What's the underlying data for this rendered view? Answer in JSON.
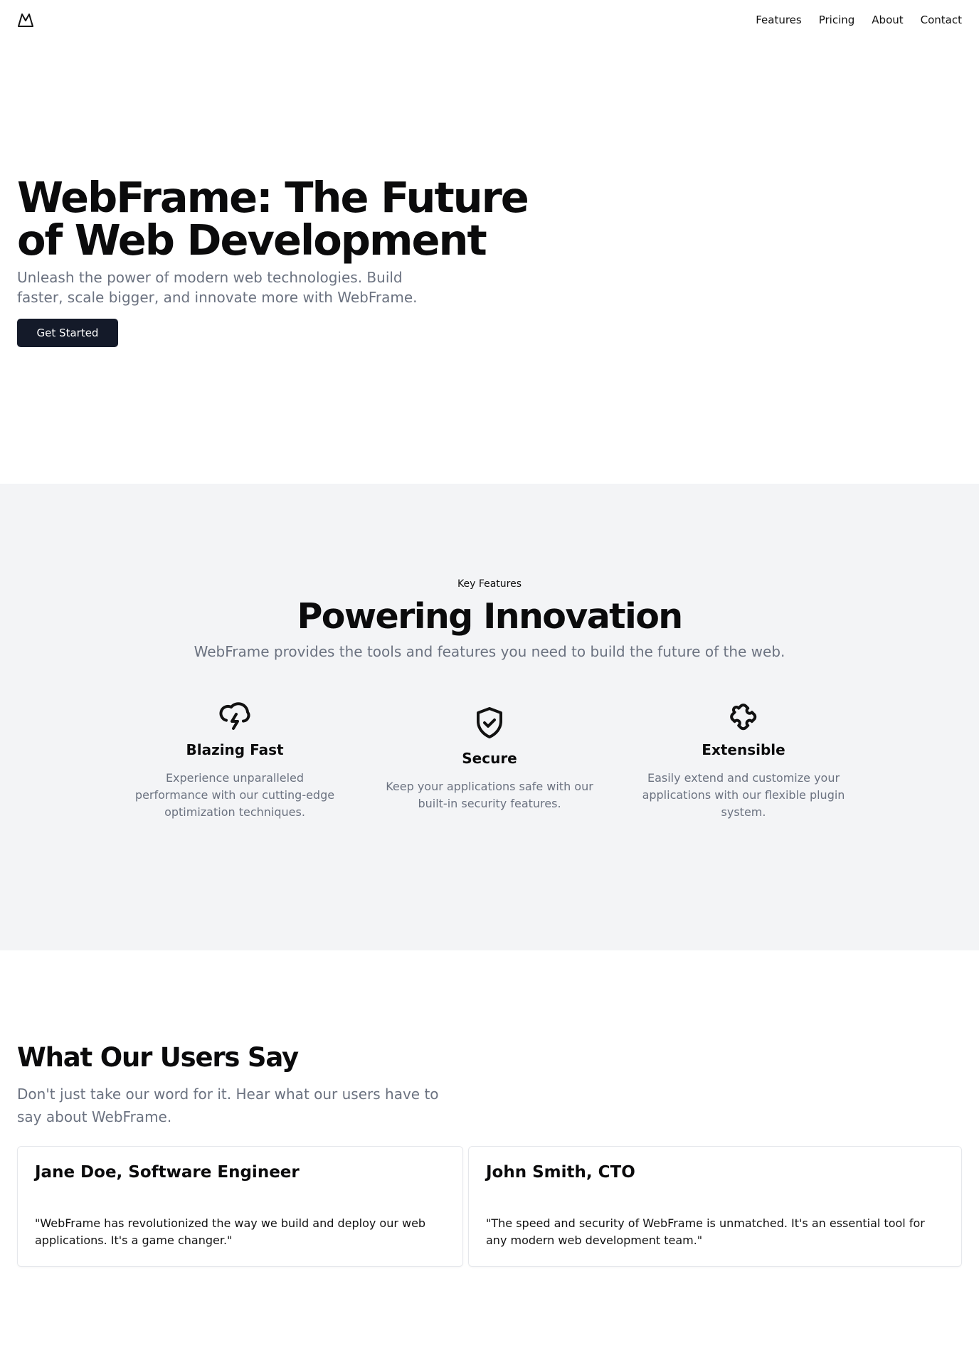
{
  "header": {
    "logo_icon": "mountain-icon",
    "nav": [
      {
        "label": "Features"
      },
      {
        "label": "Pricing"
      },
      {
        "label": "About"
      },
      {
        "label": "Contact"
      }
    ]
  },
  "hero": {
    "title": "WebFrame: The Future of Web Development",
    "subtitle": "Unleash the power of modern web technologies. Build faster, scale bigger, and innovate more with WebFrame.",
    "cta_label": "Get Started"
  },
  "features": {
    "eyebrow": "Key Features",
    "title": "Powering Innovation",
    "subtitle": "WebFrame provides the tools and features you need to build the future of the web.",
    "items": [
      {
        "icon": "cloud-lightning-icon",
        "title": "Blazing Fast",
        "description": "Experience unparalleled performance with our cutting-edge optimization techniques."
      },
      {
        "icon": "shield-check-icon",
        "title": "Secure",
        "description": "Keep your applications safe with our built-in security features."
      },
      {
        "icon": "puzzle-icon",
        "title": "Extensible",
        "description": "Easily extend and customize your applications with our flexible plugin system."
      }
    ]
  },
  "testimonials": {
    "title": "What Our Users Say",
    "subtitle": "Don't just take our word for it. Hear what our users have to say about WebFrame.",
    "items": [
      {
        "name": "Jane Doe, Software Engineer",
        "quote": "\"WebFrame has revolutionized the way we build and deploy our web applications. It's a game changer.\""
      },
      {
        "name": "John Smith, CTO",
        "quote": "\"The speed and security of WebFrame is unmatched. It's an essential tool for any modern web development team.\""
      }
    ]
  },
  "colors": {
    "primary_button": "#141a29",
    "muted_text": "#6b7280",
    "section_bg": "#f3f4f6",
    "card_border": "#e5e7eb"
  }
}
